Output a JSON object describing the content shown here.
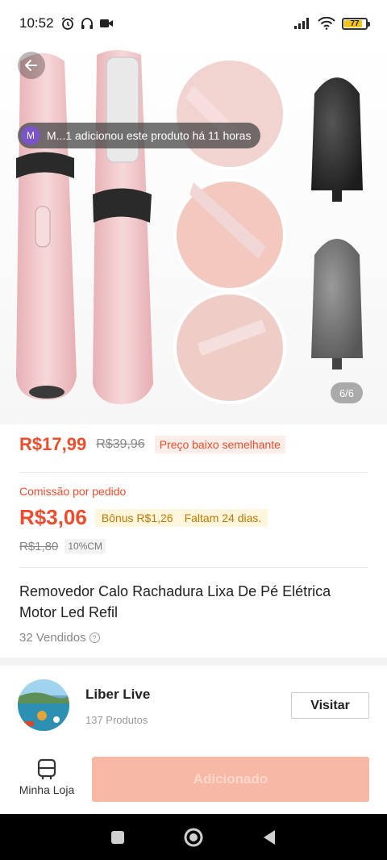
{
  "status_bar": {
    "time": "10:52",
    "battery_level": "77",
    "icons": [
      "alarm-icon",
      "headphones-icon",
      "video-icon",
      "signal-icon",
      "wifi-icon",
      "battery-icon"
    ]
  },
  "hero": {
    "notification_avatar_letter": "M",
    "notification_text": "M...1 adicionou este produto há 11 horas",
    "image_counter": "6/6",
    "colors": {
      "device_pink": "#f2c9cb",
      "roller_dark": "#2b2b2b",
      "roller_gray": "#6b6b6b"
    }
  },
  "price": {
    "current": "R$17,99",
    "original": "R$39,96",
    "tag": "Preço baixo semelhante"
  },
  "commission": {
    "label": "Comissão por pedido",
    "value": "R$3,06",
    "bonus": "Bônus R$1,26",
    "remaining": "Faltam 24 dias.",
    "old_value": "R$1,80",
    "rate": "10%CM"
  },
  "product": {
    "title": "Removedor Calo Rachadura Lixa De Pé Elétrica Motor Led Refil",
    "sold": "32 Vendidos"
  },
  "shop": {
    "name": "Liber Live",
    "products": "137 Produtos",
    "visit_label": "Visitar"
  },
  "bottom_bar": {
    "my_store_label": "Minha Loja",
    "action_label": "Adicionado"
  },
  "colors": {
    "accent": "#ee4d2d",
    "button_disabled": "#f8b8a6"
  }
}
